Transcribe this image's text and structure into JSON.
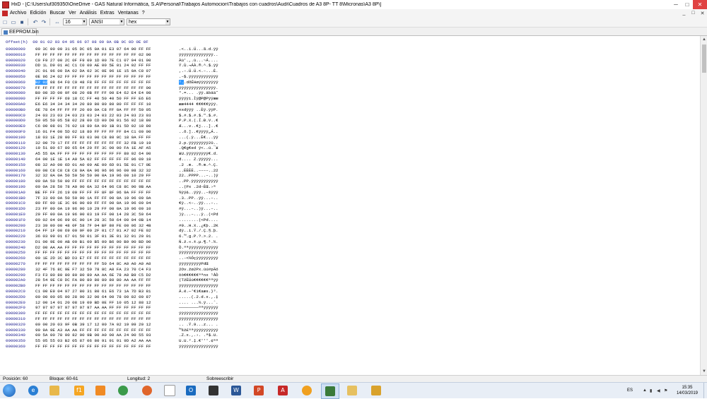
{
  "window": {
    "title": "HxD - [C:\\Users\\uf309350\\OneDrive - GAS Natural Informática, S.A\\Personal\\Trabajos Automocion\\Trabajos con cuadros\\Audi\\Cuadros de A3 8P- TT 8\\Micronas\\A3 8P\\]",
    "minimize": "─",
    "maximize": "□",
    "close": "✕"
  },
  "menu": {
    "items": [
      "Archivo",
      "Edición",
      "Buscar",
      "Ver",
      "Análisis",
      "Extras",
      "Ventanas",
      "?"
    ],
    "mdi_controls": [
      "_",
      "□",
      "✕"
    ]
  },
  "toolbar": {
    "columns_value": "16",
    "charset_value": "ANSI",
    "display_value": "hex"
  },
  "tabs": [
    {
      "label": "EEPROM.bin"
    }
  ],
  "editor": {
    "header": "Offset(h)  00 01 02 03 04 05 06 07 08 09 0A 0B 0C 0D 0E 0F",
    "selected_offset": "00000060",
    "selected_hex": "B2 02",
    "selected_text": "²."
  },
  "rows": [
    {
      "off": "00000000",
      "hex": "00 3C 00 00 31 05 DC 05 0A 01 E3 07 64 00 FF FF",
      "asc": ".<..1.Ü...ã.d.ÿÿ"
    },
    {
      "off": "00000010",
      "hex": "FF FF FF FF FF FF FF FF FF FF FF FF FF FF 02 00",
      "asc": "ÿÿÿÿÿÿÿÿÿÿÿÿÿÿ.."
    },
    {
      "off": "00000020",
      "hex": "C0 F9 27 00 2C 0F F9 09 1D 00 7E C1 07 04 01 00",
      "asc": "Àù'.,.ù...~Á...."
    },
    {
      "off": "00000030",
      "hex": "DD 1L D9 01 AC C1 C0 00 AE 00 5E 01 24 02 FF FF",
      "asc": "Ý.Ù.¬ÁÀ.®.^.$.ÿÿ"
    },
    {
      "off": "00000040",
      "hex": "2C 01 96 00 DA 02 DA 02 3C 0E 96 1E 15 0A C8 07",
      "asc": ",.–.Ú.Ú.<.–...È."
    },
    {
      "off": "00000050",
      "hex": "0E 96 24 02 FF FF FF FF FF FF FF FF FF FF FF FF",
      "asc": ".–$.ÿÿÿÿÿÿÿÿÿÿÿÿ"
    },
    {
      "off": "00000060",
      "hex": "B2 02 08 64 F0 C9 48 F8 FF FF FF FF FF FF FF FF",
      "asc": "²..dðÉHøÿÿÿÿÿÿÿÿ",
      "sel": true
    },
    {
      "off": "00000070",
      "hex": "FF FF FF FF FF FF FF FF FF FF FF FF FF FF FF 00",
      "asc": "ÿÿÿÿÿÿÿÿÿÿÿÿÿÿÿ."
    },
    {
      "off": "00000080",
      "hex": "B0 08 3D 00 0F 08 20 0B FF FF 00 E4 62 E4 E4 98",
      "asc": "°.=... .ÿÿ.äbää˜"
    },
    {
      "off": "00000090",
      "hex": "FF FF FF FF 69 18 CC FF 40 50 40 50 FF FF E6 E6",
      "asc": "ÿÿÿÿi.Ìÿ@P@Pÿÿææ"
    },
    {
      "off": "000000A0",
      "hex": "E6 E6 34 34 34 34 20 80 80 80 80 80 FF FF FF 10",
      "asc": "ææ4444 €€€€€ÿÿÿ."
    },
    {
      "off": "000000B0",
      "hex": "6E 78 64 FF FF FF 20 00 0A C8 FF 0A FF FF 50 05",
      "asc": "nxdÿÿÿ ..Èÿ.ÿÿP."
    },
    {
      "off": "000000C0",
      "hex": "24 03 23 03 24 03 23 03 24 03 22 03 24 03 23 03",
      "asc": "$.#.$.#.$.\".$.#."
    },
    {
      "off": "000000D0",
      "hex": "50 05 50 05 58 02 28 00 CD 00 D0 01 56 02 18 80",
      "asc": "P.P.X.(.Í.Ð.V..€"
    },
    {
      "off": "000000E0",
      "hex": "C6 00 08 01 76 02 18 80 6A 00 1B 01 5D 02 18 80",
      "asc": "Æ...v..€j...]..€"
    },
    {
      "off": "000000F0",
      "hex": "16 01 F4 00 5D 02 18 80 FF FF FF FF 84 C1 00 00",
      "asc": "..ô.]..€ÿÿÿÿ„Á.."
    },
    {
      "off": "00000100",
      "hex": "18 03 1E 28 00 FF 03 03 00 C8 80 0C 18 0A FF FF",
      "asc": "...(.ÿ...È€...ÿÿ"
    },
    {
      "off": "00000110",
      "hex": "32 00 70 17 FF FF FF FF FF FF FF FF 32 FB 19 19",
      "asc": "2.p.ÿÿÿÿÿÿÿÿ2û.."
    },
    {
      "off": "00000120",
      "hex": "19 51 80 67 80 65 64 20 FF 3C 00 00 FA 1E AF A5",
      "asc": ".Q€g€ed ÿ<..ú.¯¥"
    },
    {
      "off": "00000130",
      "hex": "A5 55 0A FF FF FF FF FF FF FF FF FF 80 02 64 00",
      "asc": "¥U.ÿÿÿÿÿÿÿÿÿ€.d."
    },
    {
      "off": "00000140",
      "hex": "64 00 1E 1E 14 A0 5A 02 FF FF FF FF FF 06 09 18",
      "asc": "d.... Z.ÿÿÿÿÿ..."
    },
    {
      "off": "00000150",
      "hex": "08 32 A0 00 6D 01 A0 00 AE 00 6D 01 5E 01 C7 0E",
      "asc": ".2 .m. .®.m.^.Ç."
    },
    {
      "off": "00000160",
      "hex": "00 08 C8 C8 C8 C8 0A 0A 96 96 96 96 00 08 32 32",
      "asc": "..ÈÈÈÈ..––––..22"
    },
    {
      "off": "00000170",
      "hex": "32 32 0A 0A 50 50 50 50 00 0A 19 96 00 10 29 FF",
      "asc": "22..PPPP...–..)ÿ"
    },
    {
      "off": "00000180",
      "hex": "00 0A 50 50 00 FF FF FF FF FF FF FF FF FF FF FF",
      "asc": "..PP.ÿÿÿÿÿÿÿÿÿÿÿ"
    },
    {
      "off": "00000190",
      "hex": "00 0A 28 50 78 A0 00 0A 32 64 96 C8 8C 90 9B AA",
      "asc": "..(Px .2d–ÈŒ.›ª"
    },
    {
      "off": "000001A0",
      "hex": "BE FF FF 26 19 00 FF FF FF 8F 8F 96 9A FF FF FF",
      "asc": "¾ÿÿ&..ÿÿÿ..–šÿÿÿ"
    },
    {
      "off": "000001B0",
      "hex": "7F 33 00 0A 50 50 00 1A FF FF 00 0A 19 96 00 0A",
      "asc": ".3..PP..ÿÿ...–.."
    },
    {
      "off": "000001C0",
      "hex": "80 FF 00 1E 3C 96 00 00 FF FF 00 0A 19 96 00 04",
      "asc": "€ÿ..<–..ÿÿ...–.."
    },
    {
      "off": "000001D0",
      "hex": "23 FF 00 0A 19 96 00 10 29 FF 00 0A 19 96 00 10",
      "asc": "#ÿ...–..)ÿ...–.."
    },
    {
      "off": "000001E0",
      "hex": "29 FF 00 0A 19 96 00 03 19 FF 00 14 28 3C 50 64",
      "asc": ")ÿ...–...ÿ..(<Pd"
    },
    {
      "off": "000001F0",
      "hex": "00 02 04 06 09 0C 00 14 28 3C 50 64 00 04 0B 14",
      "asc": "........(<Pd...."
    },
    {
      "off": "00000200",
      "hex": "23 39 00 00 48 0F 58 7F 04 BF 80 FE 00 06 32 4B",
      "asc": "#9..H.X..¿€þ..2K"
    },
    {
      "off": "00000210",
      "hex": "64 FF 1F 00 69 00 9F 00 2F 01 C7 01 A7 02 FE 02",
      "asc": "dÿ..i.Ÿ./.Ç.§.þ."
    },
    {
      "off": "00000220",
      "hex": "36 03 99 01 67 01 50 01 3F 01 3E 01 32 01 20 01",
      "asc": "6.™.g.P.?.>.2. ."
    },
    {
      "off": "00000230",
      "hex": "D1 00 9E 00 AB 00 B1 00 B5 00 B6 00 B9 00 BD 00",
      "asc": "Ñ.ž.«.±.µ.¶.¹.½."
    },
    {
      "off": "00000240",
      "hex": "D2 00 AA AA FF FF FF FF FF FF FF FF FF FF FF FF",
      "asc": "Ò.ªªÿÿÿÿÿÿÿÿÿÿÿÿ"
    },
    {
      "off": "00000250",
      "hex": "FF FF FF FF FF FF FF FF FF FF FF FF FF FF FF FF",
      "asc": "ÿÿÿÿÿÿÿÿÿÿÿÿÿÿÿÿ"
    },
    {
      "off": "00000260",
      "hex": "00 1E 2D 3C BD D3 E7 FF FF FF FF FF FF FF FF FF",
      "asc": "..-<½Óçÿÿÿÿÿÿÿÿÿ"
    },
    {
      "off": "00000270",
      "hex": "FF FF FF FF FF FF FF FF FF 50 64 8C A0 A0 A0 A0",
      "asc": "ÿÿÿÿÿÿÿÿÿPdŒ    "
    },
    {
      "off": "00000280",
      "hex": "32 4F 76 8C 9E F7 32 50 78 8C A0 FA 23 70 C4 F3",
      "asc": "2Ov.žø2Px.úú#pÄó"
    },
    {
      "off": "00000290",
      "hex": "F3 F3 80 80 80 80 80 80 AA AA 6E 78 A0 B9 C5 D2",
      "asc": "òò€€€€€€ªªnx ¹ÅÒ"
    },
    {
      "off": "000002A0",
      "hex": "28 54 9E C8 DC FA 80 80 80 80 80 80 AA AA FF FF",
      "asc": "(TžÈÜú€€€€€€ªªÿÿ"
    },
    {
      "off": "000002B0",
      "hex": "FF FF FF FF FF FF FF FF FF FF FF FF FF FF FF FF",
      "asc": "ÿÿÿÿÿÿÿÿÿÿÿÿÿÿÿÿ"
    },
    {
      "off": "000002C0",
      "hex": "C1 00 E9 04 97 27 80 31 80 61 E6 73 1A 7D B3 81",
      "asc": "Á.é.—'€1€aæs.}³."
    },
    {
      "off": "000002D0",
      "hex": "00 00 00 05 00 28 00 32 00 64 00 78 00 82 00 87",
      "asc": ".....(.2.d.x.‚.‡"
    },
    {
      "off": "000002E0",
      "hex": "12 00 14 01 20 08 19 09 BD 0E FF 10 05 12 88 12",
      "asc": ".... ...½.ÿ...ˆ."
    },
    {
      "off": "000002F0",
      "hex": "97 97 97 97 97 97 97 97 AA AA FF FF FF FF FF FF",
      "asc": "————————ªªÿÿÿÿÿÿ"
    },
    {
      "off": "00000300",
      "hex": "FF FF FF FF FF FF FF FF FF FF FF FF FF FF FF FF",
      "asc": "ÿÿÿÿÿÿÿÿÿÿÿÿÿÿÿÿ"
    },
    {
      "off": "00000310",
      "hex": "FF FF FF FF FF FF FF FF FF FF FF FF FF FF FF FF",
      "asc": "ÿÿÿÿÿÿÿÿÿÿÿÿÿÿÿÿ"
    },
    {
      "off": "00000320",
      "hex": "00 00 20 03 9F 0B 39 17 12 00 7A 02 19 09 20 12",
      "asc": ".. .Ÿ.9...z... ."
    },
    {
      "off": "00000330",
      "hex": "99 9A 9E A3 AA AA FF FF FF FF FF FF FF FF FF FF",
      "asc": "™šž£ªªÿÿÿÿÿÿÿÿÿÿ"
    },
    {
      "off": "00000340",
      "hex": "00 5A 00 78 00 82 00 9B 00 A0 00 AA 24 00 55 03",
      "asc": ".Z.x.‚.›. .ª$.U."
    },
    {
      "off": "00000350",
      "hex": "55 05 55 03 B2 05 87 06 80 91 91 91 9D A2 AA AA",
      "asc": "U.U.².‡.€'''.¢ªª"
    },
    {
      "off": "00000360",
      "hex": "FF FF FF FF FF FF FF FF FF FF FF FF FF FF FF FF",
      "asc": "ÿÿÿÿÿÿÿÿÿÿÿÿÿÿÿÿ"
    }
  ],
  "status": {
    "position": "Posición: 60",
    "block": "Bloque: 60-61",
    "length": "Longitud: 2",
    "mode": "Sobreescribir"
  },
  "taskbar": {
    "language": "ES",
    "time": "15:35",
    "date": "14/03/2019"
  }
}
